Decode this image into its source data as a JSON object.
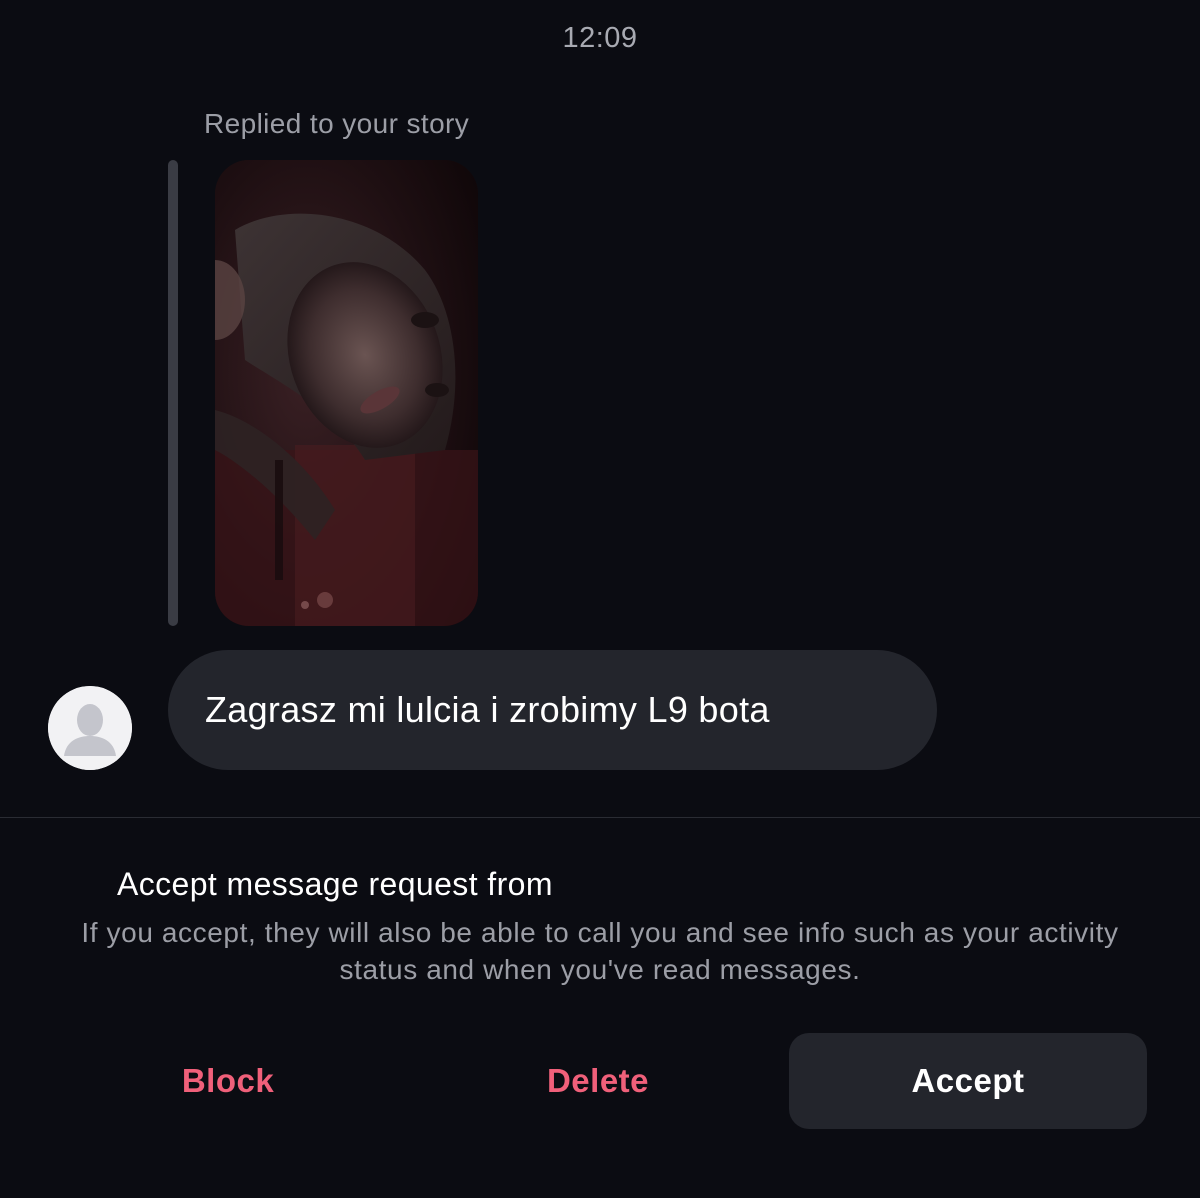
{
  "timestamp": "12:09",
  "story": {
    "caption": "Replied to your story",
    "thumbnail_icon": "story-photo-thumbnail"
  },
  "message": {
    "text": "Zagrasz mi lulcia i zrobimy L9 bota",
    "avatar_icon": "default-user-avatar-icon"
  },
  "request": {
    "title": "Accept message request from",
    "info": "If you accept, they will also be able to call you and see info such as your activity status and when you've read messages."
  },
  "actions": {
    "block_label": "Block",
    "delete_label": "Delete",
    "accept_label": "Accept"
  },
  "colors": {
    "background": "#0b0c12",
    "bubble": "#23252c",
    "danger": "#f0607a",
    "muted_text": "#9c9ea6"
  }
}
